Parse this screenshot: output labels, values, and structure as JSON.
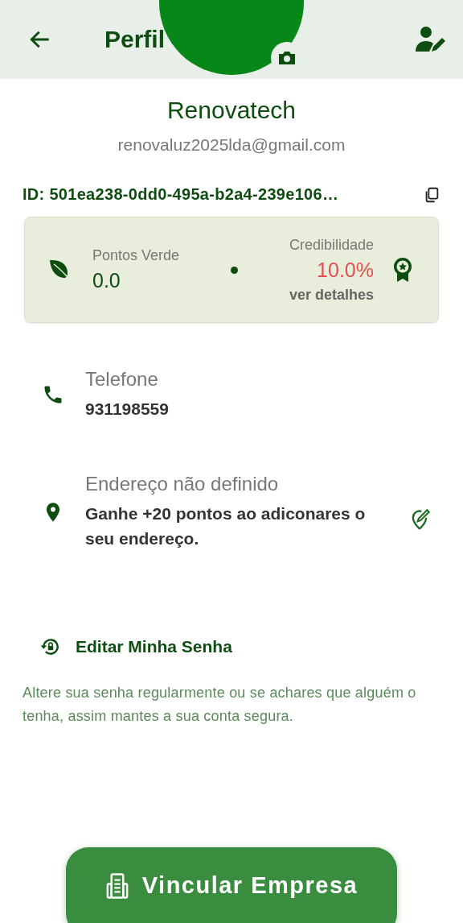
{
  "header": {
    "title": "Perfil"
  },
  "profile": {
    "name": "Renovatech",
    "email": "renovaluz2025lda@gmail.com",
    "id": "ID: 501ea238-0dd0-495a-b2a4-239e106…"
  },
  "stats": {
    "points_label": "Pontos Verde",
    "points": "0.0",
    "credibility_label": "Credibilidade",
    "credibility": "10.0%",
    "details_link": "ver detalhes"
  },
  "info": [
    {
      "kind": "phone",
      "label": "Telefone",
      "value": "931198559",
      "editable": false
    },
    {
      "kind": "address",
      "label": "Endereço não definido",
      "value": "Ganhe +20 pontos ao adiconares o seu endereço.",
      "editable": true
    }
  ],
  "password": {
    "title": "Editar Minha Senha",
    "description": "Altere sua senha regularmente ou se achares que alguém o tenha, assim mantes a sua conta segura."
  },
  "action_button": "Vincular Empresa"
}
